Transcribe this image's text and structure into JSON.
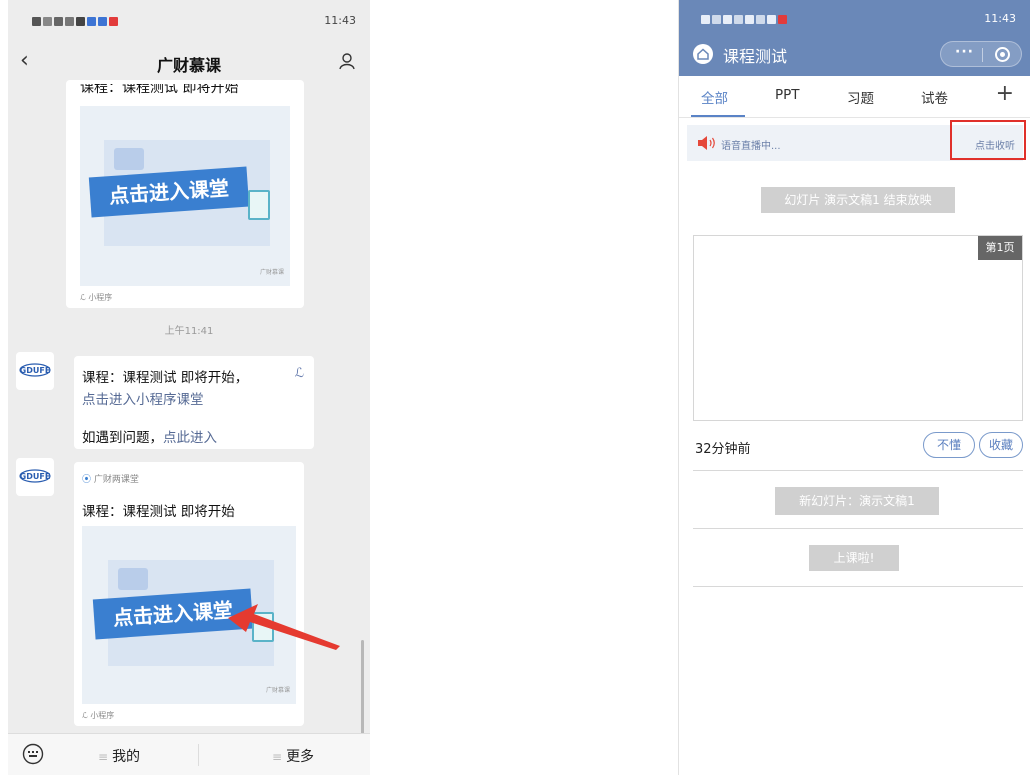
{
  "left": {
    "status_left": "▣ ²ₖ↑ᵢl ⌓ ♥ ● ▣ ▣ □",
    "status_time": "11:43",
    "nav_title": "广财慕课",
    "card_top_cut_text": "课程：课程测试 即将开始",
    "thumb_banner": "点击进入课堂",
    "thumb_watermark": "广财慕课",
    "mini_tag": "小程序",
    "timestamp": "上午11:41",
    "avatar_logo": "GDUFE",
    "msg1_line1": "课程：课程测试 即将开始，",
    "msg1_link": "点击进入小程序课堂",
    "msg1_line3_prefix": "如遇到问题，",
    "msg1_line3_link": "点此进入",
    "card_bottom_source": "广财两课堂",
    "card_bottom_title": "课程：课程测试 即将开始",
    "menu_mine": "我的",
    "menu_more": "更多"
  },
  "right": {
    "status_left": "▣ ²ₖ↑ᵢl ⌓ ♥ ● ○ ▣ ■",
    "status_time": "11:43",
    "title": "课程测试",
    "capsule_dots": "···",
    "tabs": [
      "全部",
      "PPT",
      "习题",
      "试卷"
    ],
    "live_text": "语音直播中...",
    "listen": "点击收听",
    "pill_end": "幻灯片 演示文稿1 结束放映",
    "page_label": "第1页",
    "time_ago": "32分钟前",
    "btn_dontknow": "不懂",
    "btn_fav": "收藏",
    "pill_new": "新幻灯片：演示文稿1",
    "pill_class": "上课啦!"
  },
  "colors": {
    "wechat_link": "#576b95",
    "header_blue": "#6a88b8",
    "accent_blue": "#5a83c6",
    "highlight_red": "#e0302a",
    "arrow_red": "#e53a30"
  },
  "icons": [
    "back-icon",
    "person-icon",
    "link-icon",
    "mini-program-icon",
    "keyboard-icon",
    "home-icon",
    "more-icon",
    "target-icon",
    "plus-icon",
    "speaker-icon",
    "arrow-annotation"
  ]
}
